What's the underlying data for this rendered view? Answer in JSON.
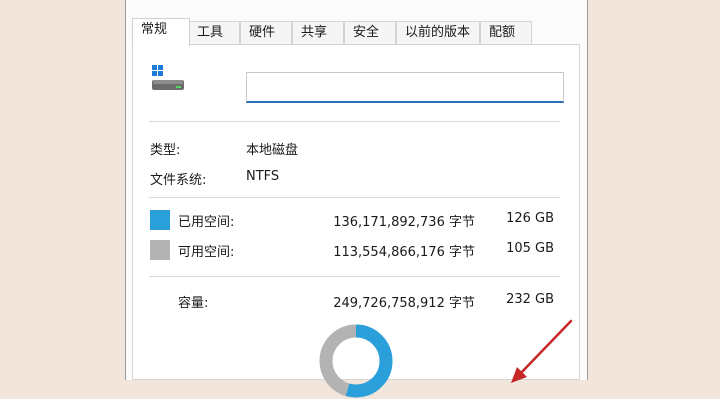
{
  "tabs": [
    {
      "label": "常规",
      "active": true
    },
    {
      "label": "工具",
      "active": false
    },
    {
      "label": "硬件",
      "active": false
    },
    {
      "label": "共享",
      "active": false
    },
    {
      "label": "安全",
      "active": false
    },
    {
      "label": "以前的版本",
      "active": false
    },
    {
      "label": "配额",
      "active": false
    }
  ],
  "drive": {
    "icon": "drive-icon",
    "name_value": ""
  },
  "info": {
    "type_label": "类型:",
    "type_value": "本地磁盘",
    "fs_label": "文件系统:",
    "fs_value": "NTFS"
  },
  "space": {
    "used_label": "已用空间:",
    "used_bytes": "136,171,892,736 字节",
    "used_gb": "126 GB",
    "used_color": "#2b9fd9",
    "free_label": "可用空间:",
    "free_bytes": "113,554,866,176 字节",
    "free_gb": "105 GB",
    "free_color": "#b3b3b3",
    "capacity_label": "容量:",
    "capacity_bytes": "249,726,758,912 字节",
    "capacity_gb": "232 GB"
  },
  "chart_data": {
    "type": "pie",
    "categories": [
      "已用空间",
      "可用空间"
    ],
    "values": [
      126,
      105
    ],
    "colors": [
      "#2b9fd9",
      "#b3b3b3"
    ]
  },
  "annotation": {
    "color": "#c62828",
    "icon": "red-arrow"
  }
}
